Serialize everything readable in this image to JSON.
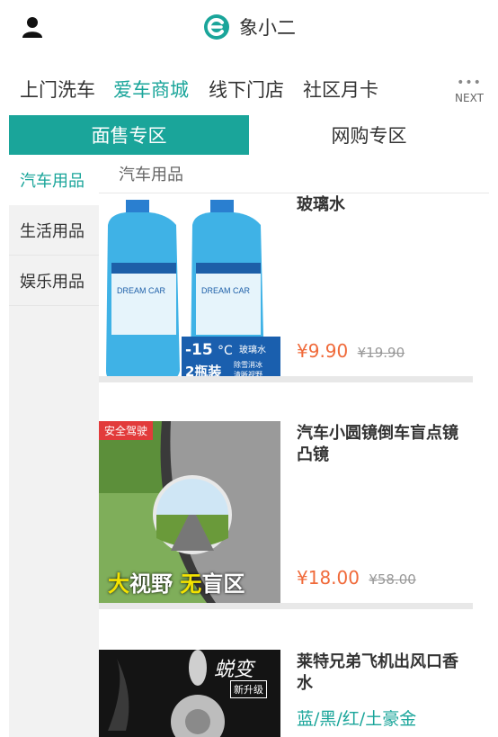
{
  "header": {
    "app_name": "象小二",
    "accent_color": "#1aa59a"
  },
  "nav": {
    "items": [
      "上门洗车",
      "爱车商城",
      "线下门店",
      "社区月卡"
    ],
    "active_index": 1,
    "next_label": "NEXT"
  },
  "tabs": {
    "active": "面售专区",
    "inactive": "网购专区"
  },
  "sidebar": {
    "items": [
      "汽车用品",
      "生活用品",
      "娱乐用品"
    ],
    "active_index": 0
  },
  "content": {
    "section_title": "汽车用品",
    "products": [
      {
        "title": "玻璃水",
        "price": "¥9.90",
        "original_price": "¥19.90",
        "image_text": {
          "temp": "-15",
          "unit": "°C",
          "type": "玻璃水",
          "qty": "2瓶装",
          "feature1": "除雪消冰",
          "feature2": "清晰视野",
          "bottle_text": "DREAM CAR"
        }
      },
      {
        "title": "汽车小圆镜倒车盲点镜凸镜",
        "price": "¥18.00",
        "original_price": "¥58.00",
        "image_text": {
          "tag": "安全驾驶",
          "slogan_1a": "大",
          "slogan_1b": "视野",
          "slogan_2a": "无",
          "slogan_2b": "盲区"
        }
      },
      {
        "title": "莱特兄弟飞机出风口香水",
        "subtitle": "蓝/黑/红/土豪金",
        "image_text": {
          "calligraphy": "蜕变",
          "tag": "新升级"
        }
      }
    ]
  }
}
